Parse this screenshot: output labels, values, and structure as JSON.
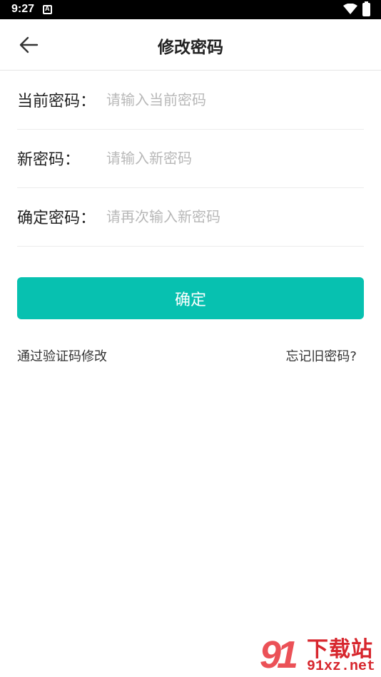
{
  "status_bar": {
    "time": "9:27",
    "notification_icon": "a-badge-icon",
    "wifi_icon": "wifi-icon",
    "battery_icon": "battery-icon"
  },
  "header": {
    "back_icon": "arrow-left-icon",
    "title": "修改密码"
  },
  "form": {
    "fields": [
      {
        "label": "当前密码：",
        "value": "",
        "placeholder": "请输入当前密码"
      },
      {
        "label": "新密码：",
        "value": "",
        "placeholder": "请输入新密码"
      },
      {
        "label": "确定密码：",
        "value": "",
        "placeholder": "请再次输入新密码"
      }
    ]
  },
  "actions": {
    "confirm_label": "确定",
    "verify_code_link": "通过验证码修改",
    "forgot_link": "忘记旧密码?"
  },
  "colors": {
    "accent": "#07c1b0",
    "watermark": "#d7262d"
  },
  "watermark": {
    "mark": "91",
    "text": "下载站",
    "url": "91xz.net"
  }
}
